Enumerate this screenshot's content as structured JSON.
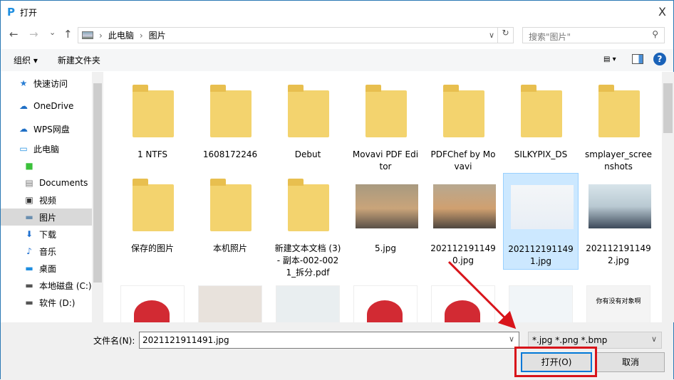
{
  "window": {
    "title": "打开",
    "close": "X"
  },
  "nav": {
    "back": "←",
    "forward": "→",
    "recent": "⌄",
    "up": "↑",
    "breadcrumb": [
      "此电脑",
      "图片"
    ],
    "search_placeholder": "搜索\"图片\""
  },
  "toolbar": {
    "organize": "组织 ▾",
    "new_folder": "新建文件夹",
    "help": "?"
  },
  "sidebar": [
    {
      "label": "快速访问",
      "icon": "star-icon"
    },
    {
      "label": "OneDrive",
      "icon": "cloud-icon"
    },
    {
      "label": "WPS网盘",
      "icon": "cloud-icon"
    },
    {
      "label": "此电脑",
      "icon": "computer-icon"
    },
    {
      "label": "",
      "icon": "app-icon"
    },
    {
      "label": "Documents",
      "icon": "document-icon"
    },
    {
      "label": "视频",
      "icon": "video-icon"
    },
    {
      "label": "图片",
      "icon": "picture-icon",
      "selected": true
    },
    {
      "label": "下载",
      "icon": "download-icon"
    },
    {
      "label": "音乐",
      "icon": "music-icon"
    },
    {
      "label": "桌面",
      "icon": "desktop-icon"
    },
    {
      "label": "本地磁盘 (C:)",
      "icon": "drive-icon"
    },
    {
      "label": "软件 (D:)",
      "icon": "drive-icon"
    }
  ],
  "files": [
    {
      "name": "1 NTFS",
      "type": "folder"
    },
    {
      "name": "1608172246",
      "type": "folder"
    },
    {
      "name": "Debut",
      "type": "folder"
    },
    {
      "name": "Movavi PDF Editor",
      "type": "folder"
    },
    {
      "name": "PDFChef by Movavi",
      "type": "folder"
    },
    {
      "name": "SILKYPIX_DS",
      "type": "folder"
    },
    {
      "name": "smplayer_screenshots",
      "type": "folder"
    },
    {
      "name": "保存的图片",
      "type": "folder"
    },
    {
      "name": "本机照片",
      "type": "folder"
    },
    {
      "name": "新建文本文档 (3) - 副本-002-0021_拆分.pdf",
      "type": "folder"
    },
    {
      "name": "5.jpg",
      "type": "image"
    },
    {
      "name": "2021121911490.jpg",
      "type": "image"
    },
    {
      "name": "2021121911491.jpg",
      "type": "image",
      "selected": true
    },
    {
      "name": "2021121911492.jpg",
      "type": "image"
    }
  ],
  "row3_thumb_text": "你有没有对象啊",
  "bottom": {
    "filename_label": "文件名(N):",
    "filename_value": "2021121911491.jpg",
    "filter": "*.jpg *.png *.bmp",
    "open": "打开(O)",
    "cancel": "取消"
  },
  "colors": {
    "accent": "#0078d7",
    "highlight": "#d8141a",
    "selection": "#cce8ff"
  }
}
